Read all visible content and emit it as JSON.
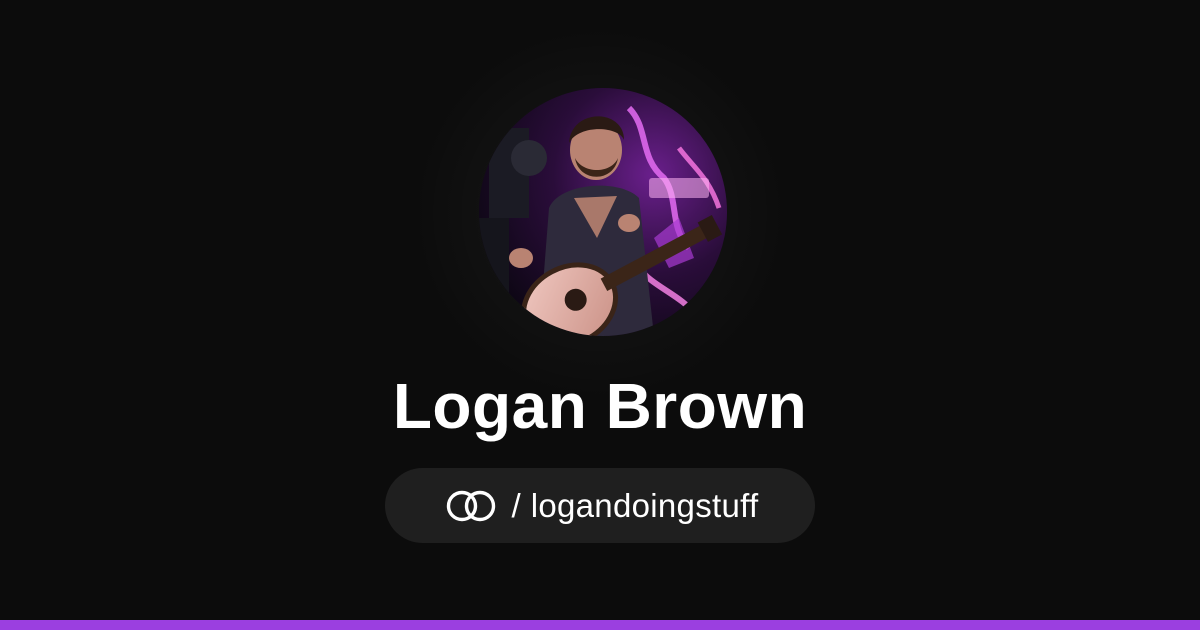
{
  "profile": {
    "name": "Logan Brown",
    "separator": "/",
    "handle": "logandoingstuff",
    "avatar_alt": "Logan Brown"
  },
  "icons": {
    "brand": "linked-rings-logo-icon"
  },
  "colors": {
    "background": "#0c0c0c",
    "pill": "#1f1f1f",
    "text": "#ffffff",
    "accent_bar": "#9b3fe0"
  }
}
